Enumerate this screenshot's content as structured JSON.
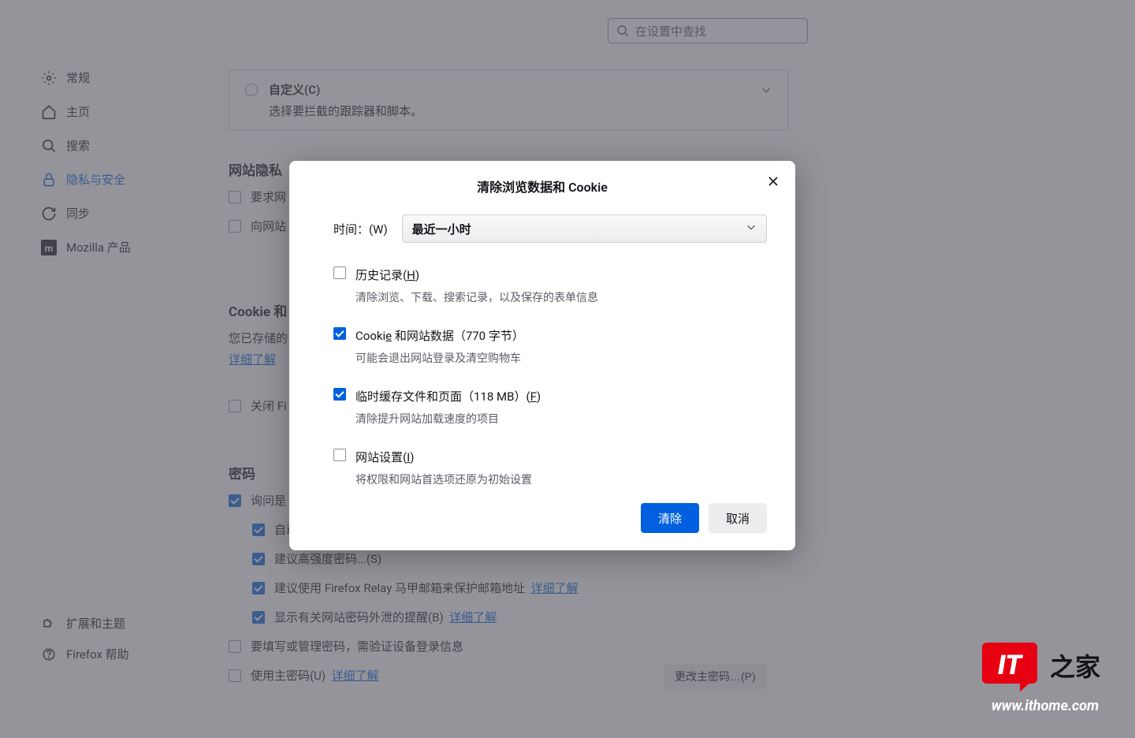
{
  "search": {
    "placeholder": "在设置中查找"
  },
  "sidebar": {
    "items": [
      {
        "label": "常规"
      },
      {
        "label": "主页"
      },
      {
        "label": "搜索"
      },
      {
        "label": "隐私与安全"
      },
      {
        "label": "同步"
      },
      {
        "label": "Mozilla 产品"
      }
    ],
    "bottom": [
      {
        "label": "扩展和主题"
      },
      {
        "label": "Firefox 帮助"
      }
    ]
  },
  "content": {
    "custom": {
      "title": "自定义(C)",
      "desc": "选择要拦截的跟踪器和脚本。"
    },
    "site_privacy_title": "网站隐私",
    "req_site_label": "要求网",
    "send_site_label": "向网站",
    "cookie_title": "Cookie 和",
    "cookie_stored": "您已存储的",
    "learn_more": "详细了解",
    "close_fi": "关闭 Fi",
    "pw_title": "密码",
    "ask_save": "询问是",
    "auto_label": "自动",
    "suggest_strong": "建议高强度密码...(S)",
    "suggest_relay": "建议使用 Firefox Relay 马甲邮箱来保护邮箱地址",
    "show_breach": "显示有关网站密码外泄的提醒(B)",
    "need_verify": "要填写或管理密码，需验证设备登录信息",
    "use_master": "使用主密码(U)",
    "change_master": "更改主密码…(P)"
  },
  "dialog": {
    "title": "清除浏览数据和 Cookie",
    "time_label": "时间：(W)",
    "time_value": "最近一小时",
    "options": [
      {
        "checked": false,
        "label": "历史记录(H)",
        "desc": "清除浏览、下载、搜索记录，以及保存的表单信息",
        "underline_char": "H"
      },
      {
        "checked": true,
        "label": "Cookie 和网站数据（770 字节）",
        "desc": "可能会退出网站登录及清空购物车",
        "underline_char": "e"
      },
      {
        "checked": true,
        "label": "临时缓存文件和页面（118 MB）(F)",
        "desc": "清除提升网站加载速度的项目",
        "underline_char": "F"
      },
      {
        "checked": false,
        "label": "网站设置(I)",
        "desc": "将权限和网站首选项还原为初始设置",
        "underline_char": "I"
      }
    ],
    "clear_btn": "清除",
    "cancel_btn": "取消"
  },
  "watermark": {
    "url": "www.ithome.com"
  }
}
